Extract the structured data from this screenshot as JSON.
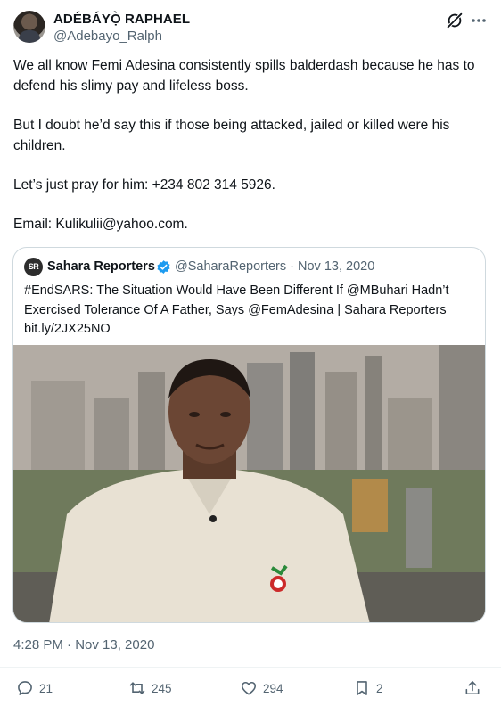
{
  "author": {
    "name": "ADÉBÁYỌ̀ RAPHAEL",
    "handle": "@Adebayo_Ralph"
  },
  "tweet": {
    "paragraphs": [
      "We all know Femi Adesina consistently spills balderdash because he has to defend his slimy pay and lifeless boss.",
      "But I doubt he’d say this if those being attacked, jailed or killed were his children.",
      "Let’s just pray for him: +234 802 314 5926.",
      "Email: Kulikulii@yahoo.com."
    ],
    "timestamp": "4:28 PM · Nov 13, 2020"
  },
  "quote": {
    "avatar_text": "SR",
    "name": "Sahara Reporters",
    "handle_date": "@SaharaReporters · Nov 13, 2020",
    "text": "#EndSARS: The Situation Would Have Been Different If @MBuhari Hadn’t Exercised Tolerance Of A Father, Says @FemAdesina | Sahara Reporters bit.ly/2JX25NO",
    "image": "photo of man in white traditional attire speaking on TV with city skyline background"
  },
  "actions": {
    "replies": "21",
    "retweets": "245",
    "likes": "294",
    "bookmarks": "2"
  },
  "colors": {
    "text": "#0f1419",
    "secondary": "#536471",
    "border": "#cfd9de",
    "verified": "#1d9bf0"
  }
}
